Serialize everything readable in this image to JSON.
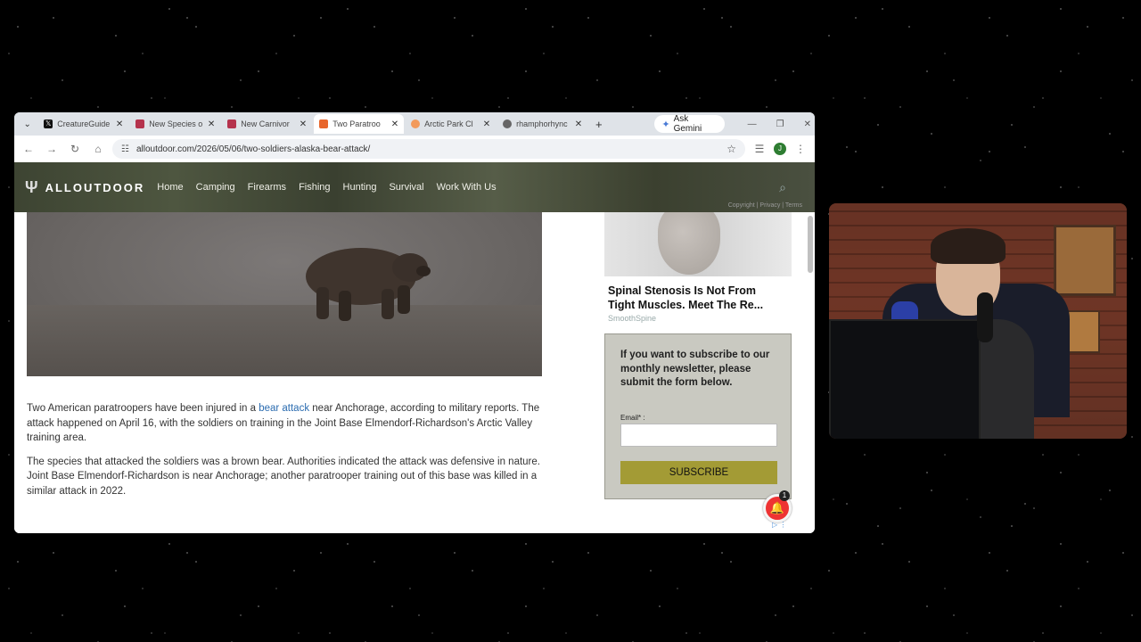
{
  "browser": {
    "tabs": [
      {
        "title": "CreatureGuide",
        "favicon": "x-logo-icon",
        "active": false
      },
      {
        "title": "New Species o",
        "favicon": "site-icon",
        "active": false
      },
      {
        "title": "New Carnivor",
        "favicon": "site-icon",
        "active": false
      },
      {
        "title": "Two Paratroo",
        "favicon": "alloutdoor-icon",
        "active": true
      },
      {
        "title": "Arctic Park Cl",
        "favicon": "site-icon",
        "active": false
      },
      {
        "title": "rhamphorhync",
        "favicon": "globe-icon",
        "active": false
      }
    ],
    "gemini_label": "Ask Gemini",
    "url": "alloutdoor.com/2026/05/06/two-soldiers-alaska-bear-attack/",
    "profile_initial": "J"
  },
  "site": {
    "logo": "ALLOUTDOOR",
    "nav": [
      "Home",
      "Camping",
      "Firearms",
      "Fishing",
      "Hunting",
      "Survival",
      "Work With Us"
    ],
    "fine_print": "Copyright | Privacy | Terms"
  },
  "article": {
    "p1_before": "Two American paratroopers have been injured in a ",
    "p1_link": "bear attack",
    "p1_after": " near Anchorage, according to military reports. The attack happened on April 16, with the soldiers on training in the Joint Base Elmendorf-Richardson's Arctic Valley training area.",
    "p2": "The species that attacked the soldiers was a brown bear. Authorities indicated the attack was defensive in nature. Joint Base Elmendorf-Richardson is near Anchorage; another paratrooper training out of this base was killed in a similar attack in 2022."
  },
  "sidebar": {
    "ad_title_1": "Spinal Stenosis Is Not From",
    "ad_title_2": "Tight Muscles. Meet The Re...",
    "ad_source": "SmoothSpine",
    "newsletter_msg": "If you want to subscribe to our monthly newsletter, please submit the form below.",
    "email_label": "Email* :",
    "subscribe_label": "SUBSCRIBE"
  },
  "notification_count": "1",
  "colors": {
    "link": "#2b6cb0",
    "subscribe_button": "#a39b35",
    "newsletter_bg": "#c9c9c1",
    "bell": "#ee3333"
  }
}
